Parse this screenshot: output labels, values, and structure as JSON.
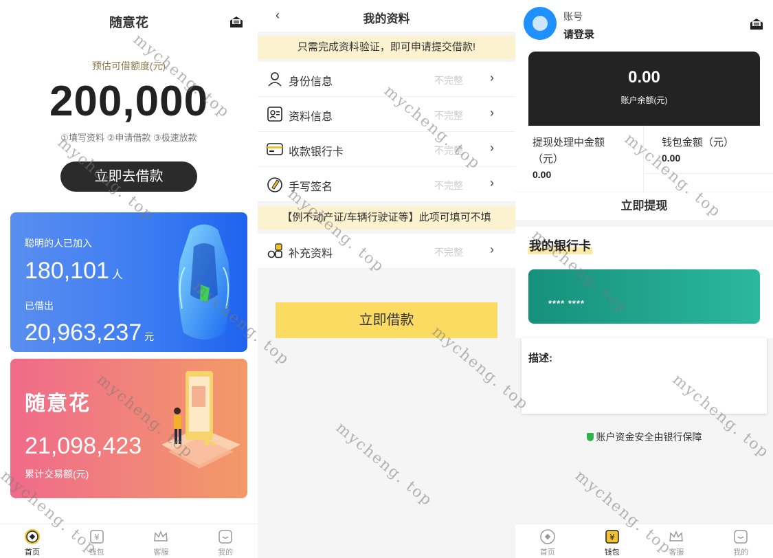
{
  "home": {
    "title": "随意花",
    "estimate_label": "预估可借额度(元)",
    "amount": "200,000",
    "steps": "①填写资料 ②申请借款 ③极速放款",
    "cta": "立即去借款",
    "stats_card": {
      "joined_label": "聪明的人已加入",
      "joined_value": "180,101",
      "joined_unit": "人",
      "borrowed_label": "已借出",
      "borrowed_value": "20,963,237",
      "borrowed_unit": "元"
    },
    "brand_card": {
      "brand": "随意花",
      "total_value": "21,098,423",
      "total_label": "累计交易额(元)"
    }
  },
  "profile": {
    "back": "‹",
    "title": "我的资料",
    "notice": "只需完成资料验证，即可申请提交借款!",
    "items": [
      {
        "label": "身份信息",
        "status": "不完整",
        "icon": "user-icon"
      },
      {
        "label": "资料信息",
        "status": "不完整",
        "icon": "id-card-icon"
      },
      {
        "label": "收款银行卡",
        "status": "不完整",
        "icon": "bank-card-icon"
      },
      {
        "label": "手写签名",
        "status": "不完整",
        "icon": "signature-icon"
      }
    ],
    "optional_notice": "【例不动产证/车辆行驶证等】此项可填可不填",
    "extra_item": {
      "label": "补充资料",
      "status": "不完整",
      "icon": "apps-icon"
    },
    "arrow": "›",
    "submit": "立即借款"
  },
  "wallet": {
    "account_label": "账号",
    "login_text": "请登录",
    "balance": "0.00",
    "balance_label": "账户余额(元)",
    "pending_label": "提现处理中金额（元）",
    "pending_value": "0.00",
    "wallet_label": "钱包金额（元）",
    "wallet_value": "0.00",
    "withdraw": "立即提现",
    "my_cards": "我的银行卡",
    "card_number": "**** ****",
    "desc_label": "描述:",
    "secure_text": "账户资金安全由银行保障"
  },
  "tabs": [
    {
      "label": "首页",
      "icon": "home-icon"
    },
    {
      "label": "钱包",
      "icon": "wallet-icon"
    },
    {
      "label": "客服",
      "icon": "crown-icon"
    },
    {
      "label": "我的",
      "icon": "profile-icon"
    }
  ],
  "watermark": "mycheng. top",
  "colors": {
    "accent": "#fcdb62",
    "dark": "#232323",
    "blue": "#3b7bf2",
    "teal": "#1fa58c"
  }
}
